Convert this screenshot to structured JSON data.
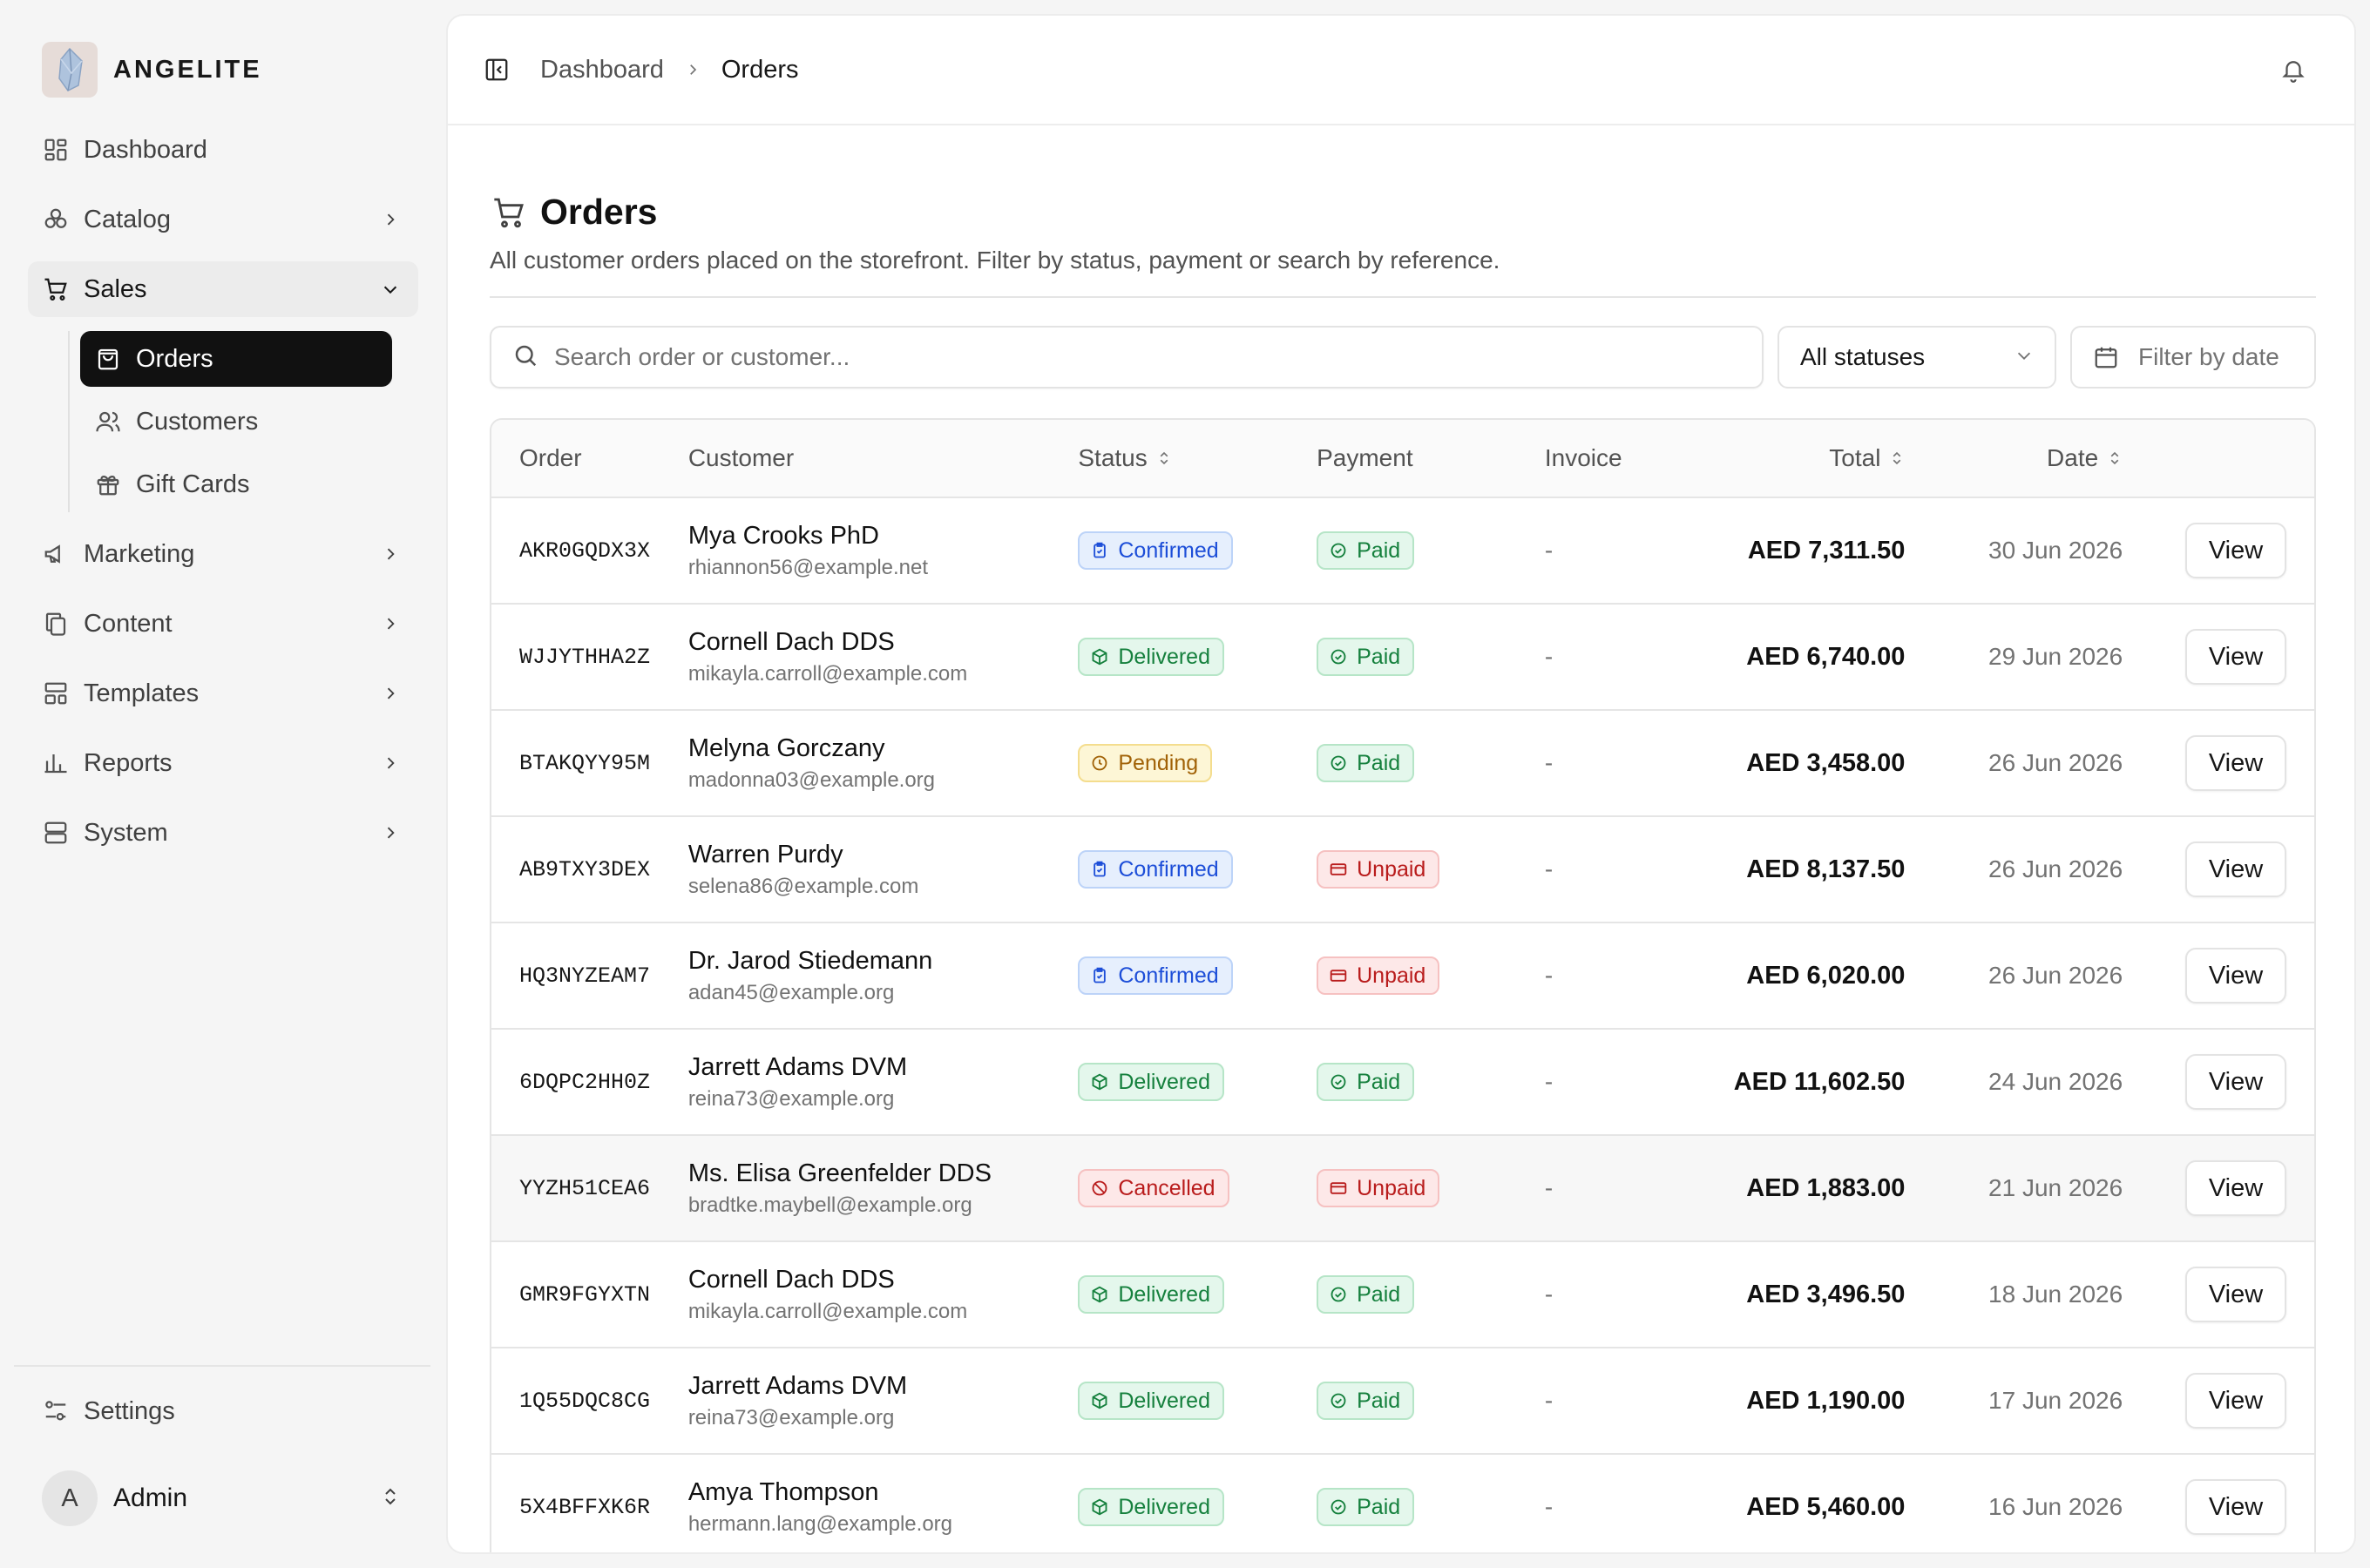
{
  "brand": {
    "name": "ANGELITE"
  },
  "sidebar": {
    "items": [
      {
        "label": "Dashboard",
        "icon": "dashboard-icon"
      },
      {
        "label": "Catalog",
        "icon": "catalog-icon"
      },
      {
        "label": "Sales",
        "icon": "cart-icon"
      },
      {
        "label": "Marketing",
        "icon": "megaphone-icon"
      },
      {
        "label": "Content",
        "icon": "copy-icon"
      },
      {
        "label": "Templates",
        "icon": "templates-icon"
      },
      {
        "label": "Reports",
        "icon": "bar-chart-icon"
      },
      {
        "label": "System",
        "icon": "server-icon"
      }
    ],
    "sales_children": [
      {
        "label": "Orders",
        "icon": "shopping-bag-icon"
      },
      {
        "label": "Customers",
        "icon": "users-icon"
      },
      {
        "label": "Gift Cards",
        "icon": "gift-icon"
      }
    ],
    "settings_label": "Settings",
    "user": {
      "initial": "A",
      "name": "Admin"
    }
  },
  "breadcrumb": {
    "parent": "Dashboard",
    "current": "Orders"
  },
  "page": {
    "title": "Orders",
    "description": "All customer orders placed on the storefront. Filter by status, payment or search by reference."
  },
  "filters": {
    "search_placeholder": "Search order or customer...",
    "status_value": "All statuses",
    "date_placeholder": "Filter by date"
  },
  "table": {
    "columns": [
      "Order",
      "Customer",
      "Status",
      "Payment",
      "Invoice",
      "Total",
      "Date"
    ],
    "view_label": "View",
    "rows": [
      {
        "order": "AKR0GQDX3X",
        "name": "Mya Crooks PhD",
        "email": "rhiannon56@example.net",
        "status": "Confirmed",
        "payment": "Paid",
        "invoice": "-",
        "total": "AED 7,311.50",
        "date": "30 Jun 2026"
      },
      {
        "order": "WJJYTHHA2Z",
        "name": "Cornell Dach DDS",
        "email": "mikayla.carroll@example.com",
        "status": "Delivered",
        "payment": "Paid",
        "invoice": "-",
        "total": "AED 6,740.00",
        "date": "29 Jun 2026"
      },
      {
        "order": "BTAKQYY95M",
        "name": "Melyna Gorczany",
        "email": "madonna03@example.org",
        "status": "Pending",
        "payment": "Paid",
        "invoice": "-",
        "total": "AED 3,458.00",
        "date": "26 Jun 2026"
      },
      {
        "order": "AB9TXY3DEX",
        "name": "Warren Purdy",
        "email": "selena86@example.com",
        "status": "Confirmed",
        "payment": "Unpaid",
        "invoice": "-",
        "total": "AED 8,137.50",
        "date": "26 Jun 2026"
      },
      {
        "order": "HQ3NYZEAM7",
        "name": "Dr. Jarod Stiedemann",
        "email": "adan45@example.org",
        "status": "Confirmed",
        "payment": "Unpaid",
        "invoice": "-",
        "total": "AED 6,020.00",
        "date": "26 Jun 2026"
      },
      {
        "order": "6DQPC2HH0Z",
        "name": "Jarrett Adams DVM",
        "email": "reina73@example.org",
        "status": "Delivered",
        "payment": "Paid",
        "invoice": "-",
        "total": "AED 11,602.50",
        "date": "24 Jun 2026"
      },
      {
        "order": "YYZH51CEA6",
        "name": "Ms. Elisa Greenfelder DDS",
        "email": "bradtke.maybell@example.org",
        "status": "Cancelled",
        "payment": "Unpaid",
        "invoice": "-",
        "total": "AED 1,883.00",
        "date": "21 Jun 2026"
      },
      {
        "order": "GMR9FGYXTN",
        "name": "Cornell Dach DDS",
        "email": "mikayla.carroll@example.com",
        "status": "Delivered",
        "payment": "Paid",
        "invoice": "-",
        "total": "AED 3,496.50",
        "date": "18 Jun 2026"
      },
      {
        "order": "1Q55DQC8CG",
        "name": "Jarrett Adams DVM",
        "email": "reina73@example.org",
        "status": "Delivered",
        "payment": "Paid",
        "invoice": "-",
        "total": "AED 1,190.00",
        "date": "17 Jun 2026"
      },
      {
        "order": "5X4BFFXK6R",
        "name": "Amya Thompson",
        "email": "hermann.lang@example.org",
        "status": "Delivered",
        "payment": "Paid",
        "invoice": "-",
        "total": "AED 5,460.00",
        "date": "16 Jun 2026"
      }
    ]
  },
  "colors": {
    "active_nav_bg": "#111111",
    "confirmed": "#1d4ed8",
    "delivered": "#15803d",
    "pending": "#a16207",
    "cancelled": "#b91c1c"
  }
}
